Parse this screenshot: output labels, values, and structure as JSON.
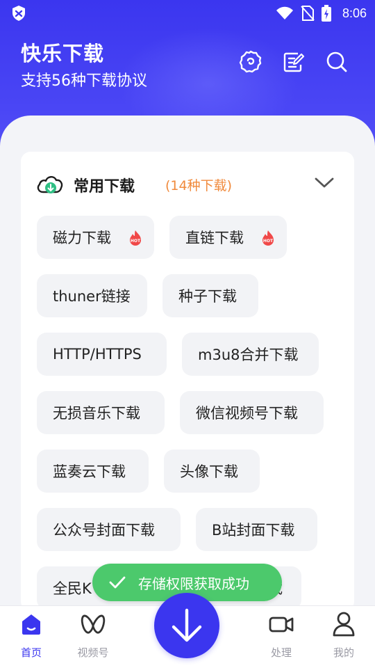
{
  "status_bar": {
    "time": "8:06",
    "icons": [
      "shield-icon",
      "wifi-icon",
      "no-sim-icon",
      "battery-charging-icon"
    ]
  },
  "header": {
    "title": "快乐下载",
    "subtitle": "支持56种下载协议",
    "actions": [
      "settings-icon",
      "notes-icon",
      "search-icon"
    ]
  },
  "section": {
    "title": "常用下载",
    "count": "(14种下载)",
    "icon": "cloud-download-icon",
    "expand_icon": "chevron-down-icon"
  },
  "chips": [
    {
      "label": "磁力下载",
      "hot": true
    },
    {
      "label": "直链下载",
      "hot": true
    },
    {
      "label": "thuner链接",
      "hot": false
    },
    {
      "label": "种子下载",
      "hot": false
    },
    {
      "label": "HTTP/HTTPS",
      "hot": false
    },
    {
      "label": "m3u8合并下载",
      "hot": false
    },
    {
      "label": "无损音乐下载",
      "hot": false
    },
    {
      "label": "微信视频号下载",
      "hot": false
    },
    {
      "label": "蓝奏云下载",
      "hot": false
    },
    {
      "label": "头像下载",
      "hot": false
    },
    {
      "label": "公众号封面下载",
      "hot": false
    },
    {
      "label": "B站封面下载",
      "hot": false
    },
    {
      "label": "全民K",
      "hot": false
    },
    {
      "label": "载",
      "hot": false
    }
  ],
  "hot_badge_text": "HOT",
  "toast": {
    "text": "存储权限获取成功",
    "icon": "check-icon"
  },
  "tabs": [
    {
      "label": "首页",
      "icon": "home-icon",
      "active": true
    },
    {
      "label": "视频号",
      "icon": "butterfly-icon",
      "active": false
    },
    {
      "label": "处理",
      "icon": "video-camera-icon",
      "active": false
    },
    {
      "label": "我的",
      "icon": "user-icon",
      "active": false
    }
  ],
  "fab_icon": "download-arrow-icon",
  "colors": {
    "primary": "#3b36ef",
    "accent_orange": "#f08a3c",
    "toast_green": "#4cc96c",
    "hot_red": "#f04848"
  }
}
